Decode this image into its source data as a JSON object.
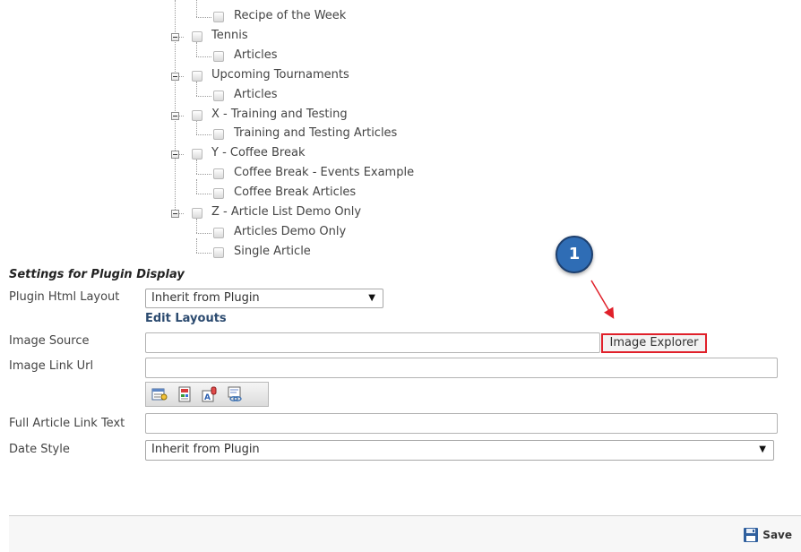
{
  "tree": {
    "nodes": [
      {
        "label": "Recipe of the Week",
        "level": 2,
        "expandable": false
      },
      {
        "label": "Tennis",
        "level": 1,
        "expandable": true
      },
      {
        "label": "Articles",
        "level": 2,
        "expandable": false
      },
      {
        "label": "Upcoming Tournaments",
        "level": 1,
        "expandable": true
      },
      {
        "label": "Articles",
        "level": 2,
        "expandable": false
      },
      {
        "label": "X - Training and Testing",
        "level": 1,
        "expandable": true
      },
      {
        "label": "Training and Testing Articles",
        "level": 2,
        "expandable": false
      },
      {
        "label": "Y - Coffee Break",
        "level": 1,
        "expandable": true
      },
      {
        "label": "Coffee Break - Events Example",
        "level": 2,
        "expandable": false
      },
      {
        "label": "Coffee Break Articles",
        "level": 2,
        "expandable": false
      },
      {
        "label": "Z - Article List Demo Only",
        "level": 1,
        "expandable": true
      },
      {
        "label": "Articles Demo Only",
        "level": 2,
        "expandable": false
      },
      {
        "label": "Single Article",
        "level": 2,
        "expandable": false
      }
    ]
  },
  "settings": {
    "title": "Settings for Plugin Display",
    "plugin_html_layout": {
      "label": "Plugin Html Layout",
      "value": "Inherit from Plugin"
    },
    "edit_layouts": "Edit Layouts",
    "image_source": {
      "label": "Image Source",
      "value": "",
      "button": "Image Explorer"
    },
    "image_link_url": {
      "label": "Image Link Url",
      "value": ""
    },
    "toolbar_icons": [
      "page-link-icon",
      "module-link-icon",
      "file-link-icon",
      "url-link-icon"
    ],
    "full_article_link_text": {
      "label": "Full Article Link Text",
      "value": ""
    },
    "date_style": {
      "label": "Date Style",
      "value": "Inherit from Plugin"
    }
  },
  "callout": {
    "number": "1",
    "color": "#2f6db5",
    "arrow_color": "#e0202a"
  },
  "footer": {
    "save_label": "Save"
  }
}
